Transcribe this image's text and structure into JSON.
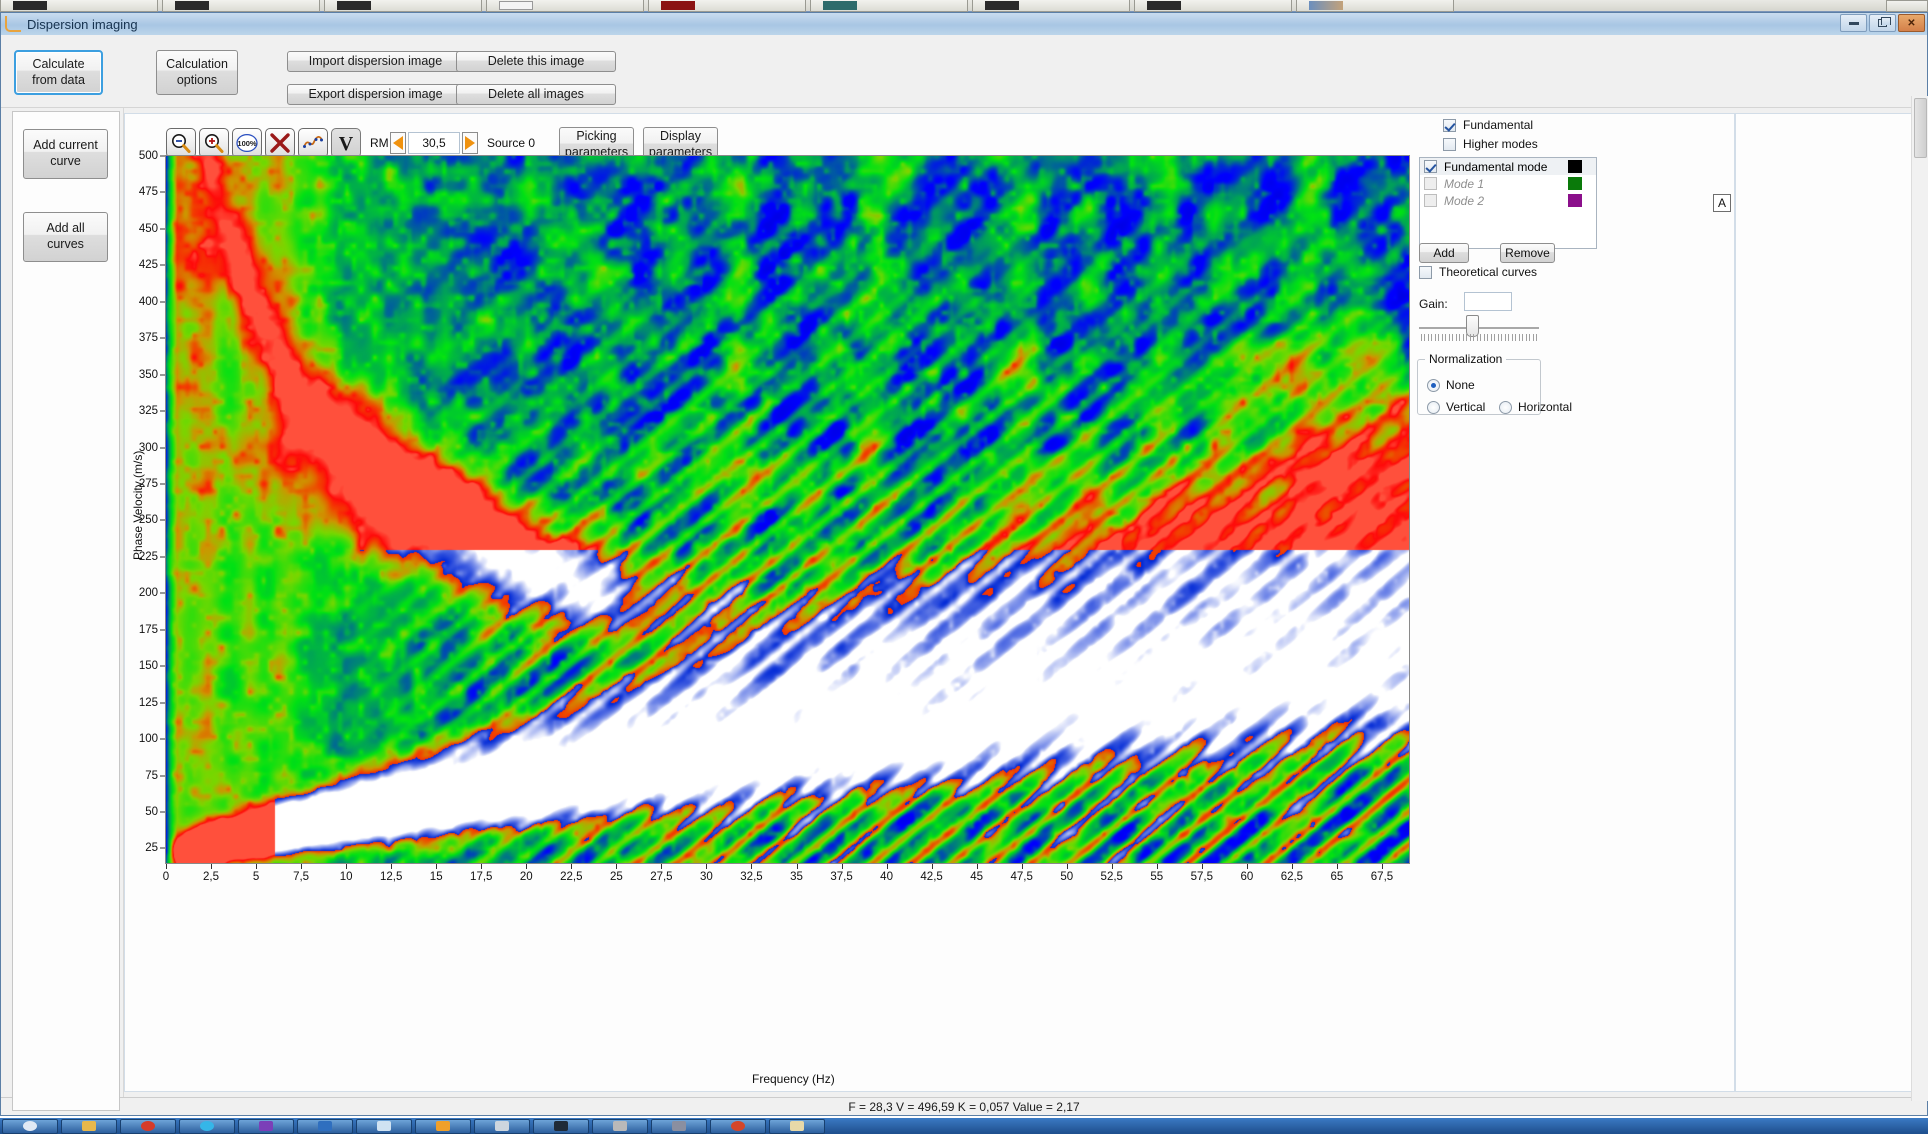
{
  "window": {
    "title": "Dispersion imaging",
    "icon": "curve-icon",
    "buttons": {
      "minimize": "minimize-icon",
      "restore": "restore-icon",
      "close": "✕"
    }
  },
  "toolbar": {
    "calculate_from_data": "Calculate\nfrom data",
    "calculation_options": "Calculation\noptions",
    "import_dispersion_image": "Import dispersion image",
    "export_dispersion_image": "Export dispersion image",
    "delete_this_image": "Delete this image",
    "delete_all_images": "Delete all images"
  },
  "left_panel": {
    "add_current_curve": "Add current\ncurve",
    "add_all_curves": "Add all\ncurves"
  },
  "plot_toolbar": {
    "icons": [
      {
        "name": "zoom-out-icon",
        "glyph": "zoom-out"
      },
      {
        "name": "zoom-in-icon",
        "glyph": "zoom-in"
      },
      {
        "name": "zoom-100-icon",
        "glyph": "100%"
      },
      {
        "name": "delete-x-icon",
        "glyph": "X"
      },
      {
        "name": "curve-pick-icon",
        "glyph": "curve"
      },
      {
        "name": "v-tool-icon",
        "glyph": "V"
      }
    ],
    "rm_label": "RM",
    "rm_value": "30,5",
    "source_label": "Source 0",
    "picking_parameters": "Picking\nparameters",
    "display_parameters": "Display\nparameters",
    "corner_marker": "A"
  },
  "right_panel": {
    "fundamental": {
      "label": "Fundamental",
      "checked": true
    },
    "higher_modes": {
      "label": "Higher modes",
      "checked": false
    },
    "modes": [
      {
        "label": "Fundamental mode",
        "checked": true,
        "enabled": true,
        "color": "#000000"
      },
      {
        "label": "Mode 1",
        "checked": false,
        "enabled": false,
        "color": "#0a7a0a"
      },
      {
        "label": "Mode 2",
        "checked": false,
        "enabled": false,
        "color": "#8b0f8b"
      }
    ],
    "add_button": "Add",
    "remove_button": "Remove",
    "theoretical_curves": {
      "label": "Theoretical curves",
      "checked": false
    },
    "gain": {
      "label": "Gain:",
      "value": "",
      "slider_percent": 44
    },
    "normalization": {
      "legend": "Normalization",
      "options": [
        {
          "label": "None",
          "selected": true
        },
        {
          "label": "Vertical",
          "selected": false
        },
        {
          "label": "Horizontal",
          "selected": false
        }
      ]
    }
  },
  "status_bar": {
    "text": "F = 28,3 V = 496,59 K = 0,057 Value = 2,17"
  },
  "chart_data": {
    "type": "heatmap",
    "title": "",
    "xlabel": "Frequency (Hz)",
    "ylabel": "Phase Velocity (m/s)",
    "xlim": [
      0,
      69
    ],
    "ylim": [
      15,
      500
    ],
    "xticks": [
      "0",
      "2,5",
      "5",
      "7,5",
      "10",
      "12,5",
      "15",
      "17,5",
      "20",
      "22,5",
      "25",
      "27,5",
      "30",
      "32,5",
      "35",
      "37,5",
      "40",
      "42,5",
      "45",
      "47,5",
      "50",
      "52,5",
      "55",
      "57,5",
      "60",
      "62,5",
      "65",
      "67,5"
    ],
    "xtick_values": [
      0,
      2.5,
      5,
      7.5,
      10,
      12.5,
      15,
      17.5,
      20,
      22.5,
      25,
      27.5,
      30,
      32.5,
      35,
      37.5,
      40,
      42.5,
      45,
      47.5,
      50,
      52.5,
      55,
      57.5,
      60,
      62.5,
      65,
      67.5
    ],
    "yticks": [
      "500",
      "475",
      "450",
      "425",
      "400",
      "375",
      "350",
      "325",
      "300",
      "275",
      "250",
      "225",
      "200",
      "175",
      "150",
      "125",
      "100",
      "75",
      "50",
      "25"
    ],
    "ytick_values": [
      500,
      475,
      450,
      425,
      400,
      375,
      350,
      325,
      300,
      275,
      250,
      225,
      200,
      175,
      150,
      125,
      100,
      75,
      50,
      25
    ],
    "grid": false,
    "legend": "none",
    "colormap": [
      "#0000ff",
      "#00c000",
      "#00ff00",
      "#ffa000",
      "#ff0000",
      "#ffffff"
    ],
    "description": "Dispersion image (frequency vs phase velocity spectrum). Dominant fundamental-mode energy ridge (red) peaks near 12-15 Hz at ~235-250 m/s then decays toward ~190 m/s by 25 Hz. A low-velocity linear trend of bright white/blue energy rises from ~25 m/s at 1 Hz to ~120 m/s at 68 Hz. Background is blue (low amplitude) with green mid-amplitude vertical striping at low frequency.",
    "hot_spots": [
      {
        "f": 13.5,
        "v": 243,
        "amp": 1.0,
        "color": "#ff0000"
      },
      {
        "f": 11.0,
        "v": 262,
        "amp": 0.8,
        "color": "#ff5a00"
      },
      {
        "f": 17.5,
        "v": 214,
        "amp": 0.7,
        "color": "#e06000"
      },
      {
        "f": 21.0,
        "v": 198,
        "amp": 0.6,
        "color": "#c87000"
      },
      {
        "f": 7.5,
        "v": 300,
        "amp": 0.55,
        "color": "#c08a00"
      },
      {
        "f": 2.6,
        "v": 430,
        "amp": 0.5,
        "color": "#b08a10"
      },
      {
        "f": 63.0,
        "v": 350,
        "amp": 0.45,
        "color": "#cc5500"
      },
      {
        "f": 59.5,
        "v": 352,
        "amp": 0.4,
        "color": "#cc5500"
      }
    ],
    "cursor_readout": {
      "F": 28.3,
      "V": 496.59,
      "K": 0.057,
      "Value": 2.17
    }
  }
}
